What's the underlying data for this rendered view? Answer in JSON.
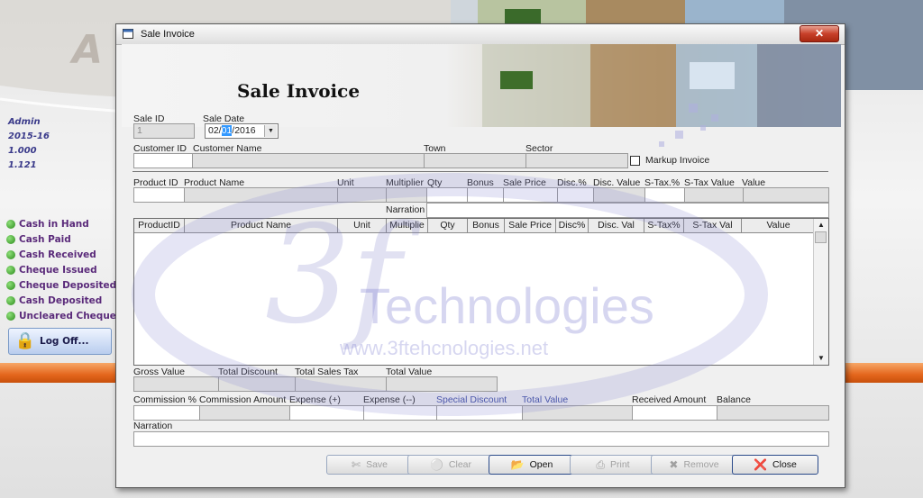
{
  "background": {
    "user_info": [
      "Admin",
      "2015-16",
      "1.000",
      "1.121"
    ],
    "menu_items": [
      "Cash in Hand",
      "Cash Paid",
      "Cash Received",
      "Cheque Issued",
      "Cheque Deposited",
      "Cash Deposited",
      "Uncleared Cheques"
    ],
    "logoff_label": "Log Off..."
  },
  "window": {
    "title": "Sale Invoice",
    "close_symbol": "✕",
    "heading": "Sale Invoice"
  },
  "form": {
    "sale_id_label": "Sale ID",
    "sale_id_value": "1",
    "sale_date_label": "Sale Date",
    "sale_date_day": "02/",
    "sale_date_month": "01",
    "sale_date_year": "/2016",
    "customer_id_label": "Customer ID",
    "customer_name_label": "Customer Name",
    "town_label": "Town",
    "sector_label": "Sector",
    "markup_label": "Markup Invoice",
    "product_id_label": "Product ID",
    "product_name_label": "Product Name",
    "unit_label": "Unit",
    "multiplier_label": "Multiplier",
    "qty_label": "Qty",
    "bonus_label": "Bonus",
    "sale_price_label": "Sale Price",
    "disc_pct_label": "Disc.%",
    "disc_value_label": "Disc. Value",
    "stax_pct_label": "S-Tax.%",
    "stax_value_label": "S-Tax Value",
    "value_label": "Value",
    "narration_label": "Narration",
    "gross_value_label": "Gross Value",
    "total_discount_label": "Total Discount",
    "total_sales_tax_label": "Total Sales Tax",
    "total_value_label": "Total Value",
    "commission_pct_label": "Commission %",
    "commission_amount_label": "Commission Amount",
    "expense_plus_label": "Expense (+)",
    "expense_minus_label": "Expense (--)",
    "special_discount_label": "Special Discount",
    "total_value2_label": "Total Value",
    "received_amount_label": "Received Amount",
    "balance_label": "Balance",
    "narration2_label": "Narration"
  },
  "grid": {
    "columns": [
      "ProductID",
      "Product Name",
      "Unit",
      "Multiplie",
      "Qty",
      "Bonus",
      "Sale Price",
      "Disc%",
      "Disc. Val",
      "S-Tax%",
      "S-Tax Val",
      "Value"
    ]
  },
  "watermark": {
    "logo": "3f",
    "name": "Technologies",
    "url": "www.3ftehcnologies.net"
  },
  "buttons": {
    "save": "Save",
    "clear": "Clear",
    "open": "Open",
    "print": "Print",
    "remove": "Remove",
    "close": "Close"
  },
  "colors": {
    "accent_orange": "#e4661c",
    "menu_text": "#5a2a7a",
    "watermark": "#6a6ad0"
  }
}
